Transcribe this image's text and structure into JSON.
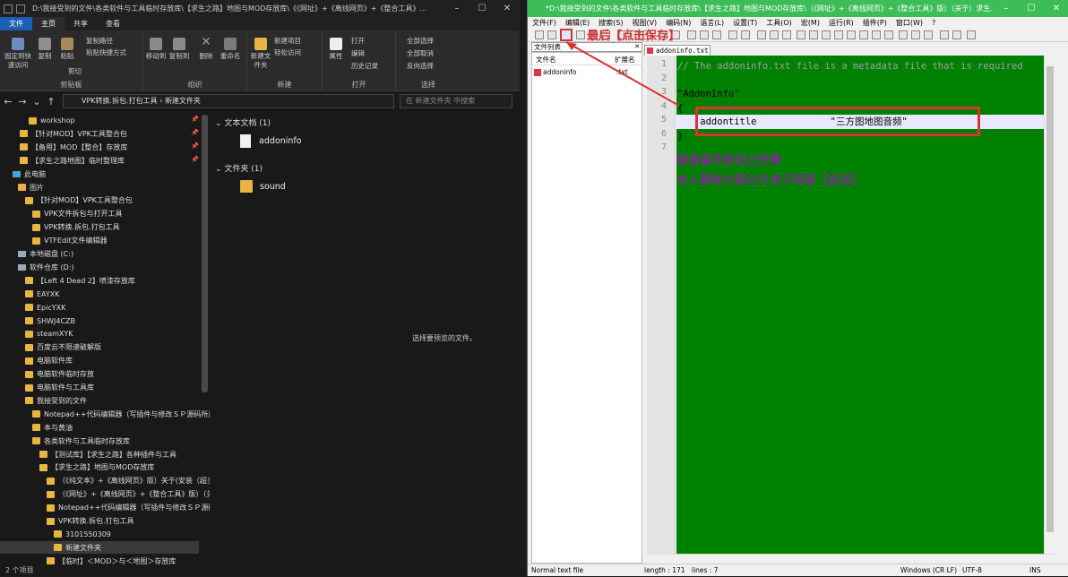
{
  "explorer": {
    "title": "D:\\我接受到的文件\\各类软件与工具临时存放库\\【求生之路】地图与MOD存放库\\《《网址》+《离线网页》+《整合工具》...",
    "ribbon_tabs": [
      "文件",
      "主页",
      "共享",
      "查看"
    ],
    "ribbon": {
      "pin_label": "固定到快速访问",
      "copy_label": "复制",
      "paste_label": "粘贴",
      "copy_path": "复制路径",
      "paste_shortcut": "粘贴快捷方式",
      "cut": "剪切",
      "move_to": "移动到",
      "copy_to": "复制到",
      "delete": "删除",
      "rename": "重命名",
      "new_folder": "新建文件夹",
      "new_item": "新建项目",
      "easy_access": "轻松访问",
      "properties": "属性",
      "open": "打开",
      "edit": "编辑",
      "history": "历史记录",
      "select_all": "全部选择",
      "select_none": "全部取消",
      "invert_selection": "反向选择",
      "groups": [
        "剪贴板",
        "组织",
        "新建",
        "打开",
        "选择"
      ]
    },
    "breadcrumb": [
      "VPK转换.拆包.打包工具",
      "新建文件夹"
    ],
    "search_placeholder": "在 新建文件夹 中搜索",
    "tree": [
      {
        "label": "workshop",
        "pinned": true
      },
      {
        "label": "【针对MOD】VPK工具整合包",
        "pinned": true
      },
      {
        "label": "【备用】MOD【整合】存放库",
        "pinned": true
      },
      {
        "label": "【求生之路地图】临时整理库",
        "pinned": true
      },
      {
        "label": "此电脑",
        "pinned": false
      },
      {
        "label": "图片",
        "pinned": false
      },
      {
        "label": "【针对MOD】VPK工具整合包",
        "pinned": false
      },
      {
        "label": "VPK文件拆包与打开工具",
        "pinned": false
      },
      {
        "label": "VPK转换.拆包.打包工具",
        "pinned": false
      },
      {
        "label": "VTFEdit文件编辑器",
        "pinned": false
      },
      {
        "label": "本地磁盘 (C:)",
        "pinned": false
      },
      {
        "label": "软件仓库 (D:)",
        "pinned": false
      },
      {
        "label": "【Left 4 Dead 2】喷漆存放库",
        "pinned": false
      },
      {
        "label": "EAYXK",
        "pinned": false
      },
      {
        "label": "EpicYXK",
        "pinned": false
      },
      {
        "label": "SHWJ4CZB",
        "pinned": false
      },
      {
        "label": "steamXYK",
        "pinned": false
      },
      {
        "label": "百度云不限速破解版",
        "pinned": false
      },
      {
        "label": "电脑软件库",
        "pinned": false
      },
      {
        "label": "电脑软件临时存放",
        "pinned": false
      },
      {
        "label": "电脑软件与工具库",
        "pinned": false
      },
      {
        "label": "我接受到的文件",
        "pinned": false
      },
      {
        "label": "Notepad++代码编辑器（写插件与修改ＳＰ源码所用",
        "pinned": false
      },
      {
        "label": "本与黄油",
        "pinned": false
      },
      {
        "label": "各类软件与工具临时存放库",
        "pinned": false
      },
      {
        "label": "【测试库】【求生之路】各种插件与工具",
        "pinned": false
      },
      {
        "label": "【求生之路】地图与MOD存放库",
        "pinned": false
      },
      {
        "label": "（《纯文本》+《离线网页》版）关于(安装（超多",
        "pinned": false
      },
      {
        "label": "（《网址》+《离线网页》+《整合工具》版）（关",
        "pinned": false
      },
      {
        "label": "Notepad++代码编辑器（写插件与修改ＳＰ源码",
        "pinned": false
      },
      {
        "label": "VPK转换.拆包.打包工具",
        "pinned": false
      },
      {
        "label": "3101550309",
        "pinned": false
      },
      {
        "label": "新建文件夹",
        "pinned": false
      },
      {
        "label": "【临时】＜MOD＞与＜地图＞存放库",
        "pinned": false
      }
    ],
    "groups": [
      {
        "header": "文本文档 (1)",
        "item": "addoninfo"
      },
      {
        "header": "文件夹 (1)",
        "item": "sound"
      }
    ],
    "preview_text": "选择要预览的文件。",
    "status": "2 个项目"
  },
  "npp": {
    "title": "*D:\\我接受到的文件\\各类软件与工具临时存放库\\【求生之路】地图与MOD存放库\\（《网址》+《离线网页》+《整合工具》版）（关于）求生...",
    "menu": [
      "文件(F)",
      "编辑(E)",
      "搜索(S)",
      "视图(V)",
      "编码(N)",
      "语言(L)",
      "设置(T)",
      "工具(O)",
      "宏(M)",
      "运行(R)",
      "插件(P)",
      "窗口(W)",
      "?"
    ],
    "file_list_title": "文件列表",
    "file_list_cols": [
      "文件名",
      "扩展名"
    ],
    "file_list_row": {
      "name": "addoninfo",
      "ext": ".txt"
    },
    "tab_label": "addoninfo.txt",
    "lines": [
      "// The addoninfo.txt file is a metadata file that is required",
      "",
      "\"AddonInfo\"",
      "{",
      "    addontitle             \"三方图地图音频\"",
      "}",
      ""
    ],
    "line_numbers": [
      "1",
      "2",
      "3",
      "4",
      "5",
      "6",
      "7"
    ],
    "annotation_save": "最后【点击保存】",
    "annotation_note1": "随意编写按自己所需",
    "annotation_note2": "本人删掉大部分文本只保留【此段】",
    "status": {
      "type": "Normal text file",
      "length": "length : 171",
      "lines": "lines : 7",
      "eol": "Windows (CR LF)",
      "encoding": "UTF-8",
      "mode": "INS"
    },
    "colors": {
      "editor_bg": "#008000",
      "title_bg": "#3cbd57",
      "annotation": "#d93434"
    }
  }
}
